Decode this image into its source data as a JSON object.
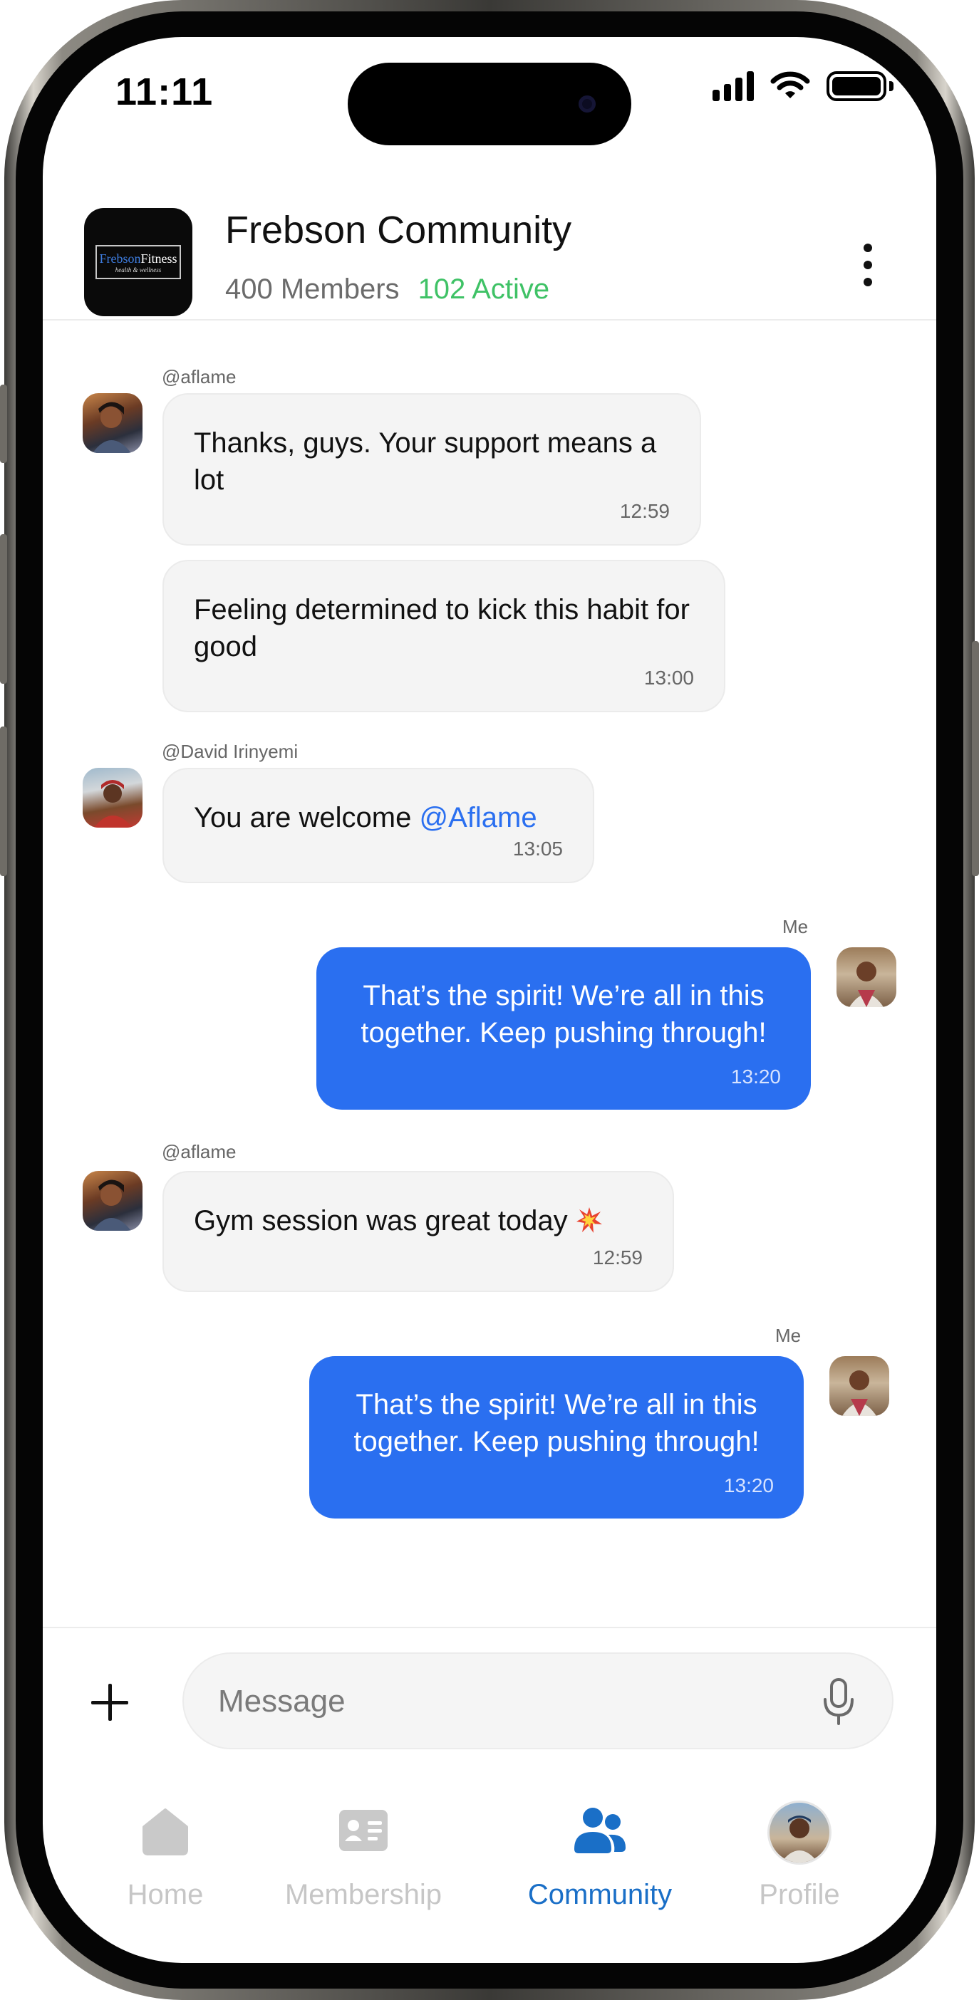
{
  "status_bar": {
    "time": "11:11"
  },
  "header": {
    "logo": {
      "brand_first": "Frebson",
      "brand_second": "Fitness",
      "tagline": "health & wellness"
    },
    "title": "Frebson Community",
    "members": "400 Members",
    "active": "102 Active"
  },
  "messages": [
    {
      "sender": "@aflame",
      "text": "Thanks, guys. Your support means a lot",
      "time": "12:59"
    },
    {
      "sender": "",
      "text": "Feeling determined to kick this habit for good",
      "time": "13:00"
    },
    {
      "sender": "@David Irinyemi",
      "text": "You are welcome",
      "mention": "@Aflame",
      "time": "13:05"
    },
    {
      "sender": "Me",
      "text": "That’s the spirit! We’re all in this together. Keep pushing through!",
      "time": "13:20"
    },
    {
      "sender": "@aflame",
      "text": "Gym session was great today",
      "time": "12:59"
    },
    {
      "sender": "Me",
      "text": "That’s the spirit! We’re all in this together. Keep pushing through!",
      "time": "13:20"
    }
  ],
  "composer": {
    "placeholder": "Message"
  },
  "tabbar": {
    "tabs": [
      {
        "label": "Home",
        "icon": "home-icon"
      },
      {
        "label": "Membership",
        "icon": "id-card-icon"
      },
      {
        "label": "Community",
        "icon": "people-icon",
        "active": true
      },
      {
        "label": "Profile",
        "icon": "profile-avatar"
      }
    ]
  },
  "colors": {
    "accent": "#2a6ff0",
    "active_green": "#3fc266",
    "tab_active": "#1a6fc7"
  }
}
